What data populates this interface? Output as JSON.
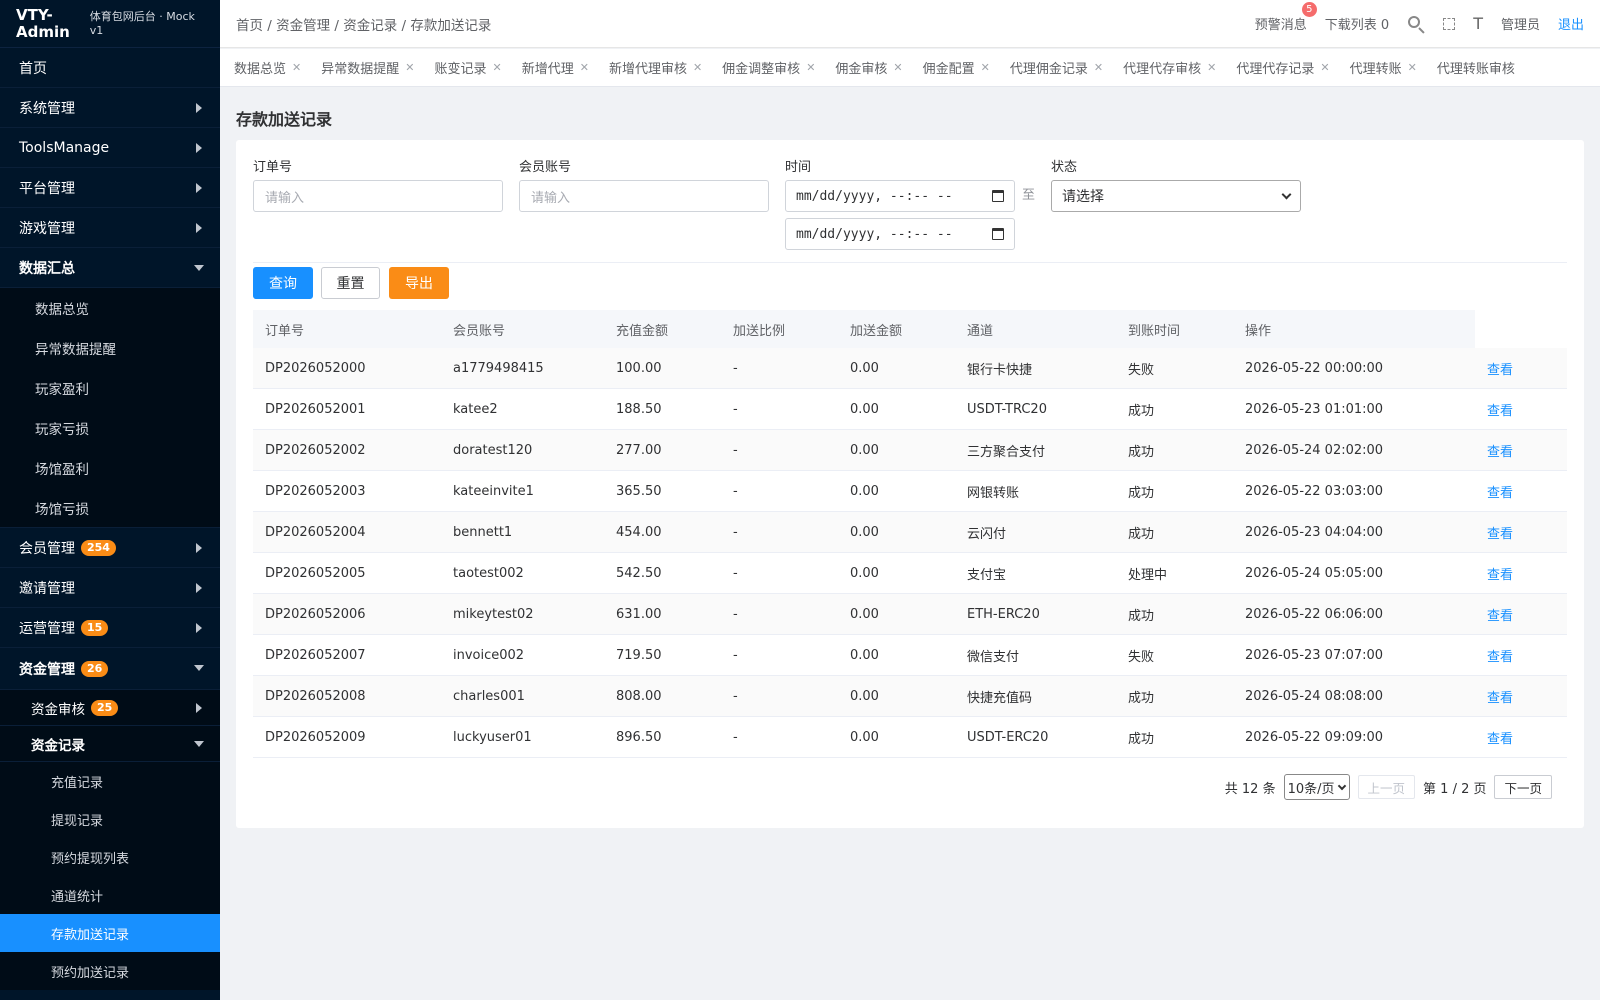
{
  "app": {
    "logo_title": "VTY-Admin",
    "logo_sub": "体育包网后台 · Mock v1"
  },
  "sidebar": {
    "items": [
      {
        "label": "首页"
      },
      {
        "label": "系统管理"
      },
      {
        "label": "ToolsManage"
      },
      {
        "label": "平台管理"
      },
      {
        "label": "游戏管理"
      },
      {
        "label": "数据汇总"
      },
      {
        "label": "数据总览"
      },
      {
        "label": "异常数据提醒"
      },
      {
        "label": "玩家盈利"
      },
      {
        "label": "玩家亏损"
      },
      {
        "label": "场馆盈利"
      },
      {
        "label": "场馆亏损"
      },
      {
        "label": "会员管理",
        "badge": "254"
      },
      {
        "label": "邀请管理"
      },
      {
        "label": "运营管理",
        "badge": "15"
      },
      {
        "label": "资金管理",
        "badge": "26"
      },
      {
        "label": "资金审核",
        "badge": "25"
      },
      {
        "label": "资金记录"
      },
      {
        "label": "充值记录"
      },
      {
        "label": "提现记录"
      },
      {
        "label": "预约提现列表"
      },
      {
        "label": "通道统计"
      },
      {
        "label": "存款加送记录"
      },
      {
        "label": "预约加送记录"
      }
    ]
  },
  "header": {
    "breadcrumb": "首页 / 资金管理 / 资金记录 / 存款加送记录",
    "alerts_label": "预警消息",
    "alerts_count": "5",
    "downloads_label": "下载列表 0",
    "font_icon": "T",
    "user": "管理员",
    "logout": "退出"
  },
  "tabs": [
    {
      "label": "数据总览"
    },
    {
      "label": "异常数据提醒"
    },
    {
      "label": "账变记录"
    },
    {
      "label": "新增代理"
    },
    {
      "label": "新增代理审核"
    },
    {
      "label": "佣金调整审核"
    },
    {
      "label": "佣金审核"
    },
    {
      "label": "佣金配置"
    },
    {
      "label": "代理佣金记录"
    },
    {
      "label": "代理代存审核"
    },
    {
      "label": "代理代存记录"
    },
    {
      "label": "代理转账"
    },
    {
      "label": "代理转账审核"
    }
  ],
  "page": {
    "title": "存款加送记录"
  },
  "filters": {
    "order_label": "订单号",
    "order_placeholder": "请输入",
    "member_label": "会员账号",
    "member_placeholder": "请输入",
    "time_label": "时间",
    "date_placeholder": "mm/dd/yyyy, --:-- --",
    "to": "至",
    "status_label": "状态",
    "status_value": "请选择"
  },
  "buttons": {
    "search": "查询",
    "reset": "重置",
    "export": "导出"
  },
  "table": {
    "headers": [
      "订单号",
      "会员账号",
      "充值金额",
      "加送比例",
      "加送金额",
      "通道",
      "到账时间",
      "操作"
    ],
    "action": "查看",
    "rows": [
      [
        "DP2026052000",
        "a1779498415",
        "100.00",
        "-",
        "0.00",
        "银行卡快捷",
        "失败",
        "2026-05-22 00:00:00"
      ],
      [
        "DP2026052001",
        "katee2",
        "188.50",
        "-",
        "0.00",
        "USDT-TRC20",
        "成功",
        "2026-05-23 01:01:00"
      ],
      [
        "DP2026052002",
        "doratest120",
        "277.00",
        "-",
        "0.00",
        "三方聚合支付",
        "成功",
        "2026-05-24 02:02:00"
      ],
      [
        "DP2026052003",
        "kateeinvite1",
        "365.50",
        "-",
        "0.00",
        "网银转账",
        "成功",
        "2026-05-22 03:03:00"
      ],
      [
        "DP2026052004",
        "bennett1",
        "454.00",
        "-",
        "0.00",
        "云闪付",
        "成功",
        "2026-05-23 04:04:00"
      ],
      [
        "DP2026052005",
        "taotest002",
        "542.50",
        "-",
        "0.00",
        "支付宝",
        "处理中",
        "2026-05-24 05:05:00"
      ],
      [
        "DP2026052006",
        "mikeytest02",
        "631.00",
        "-",
        "0.00",
        "ETH-ERC20",
        "成功",
        "2026-05-22 06:06:00"
      ],
      [
        "DP2026052007",
        "invoice002",
        "719.50",
        "-",
        "0.00",
        "微信支付",
        "失败",
        "2026-05-23 07:07:00"
      ],
      [
        "DP2026052008",
        "charles001",
        "808.00",
        "-",
        "0.00",
        "快捷充值码",
        "成功",
        "2026-05-24 08:08:00"
      ],
      [
        "DP2026052009",
        "luckyuser01",
        "896.50",
        "-",
        "0.00",
        "USDT-ERC20",
        "成功",
        "2026-05-22 09:09:00"
      ]
    ]
  },
  "pager": {
    "total": "共 12 条",
    "page_size": "10条/页",
    "prev": "上一页",
    "page_info": "第 1 / 2 页",
    "next": "下一页"
  }
}
